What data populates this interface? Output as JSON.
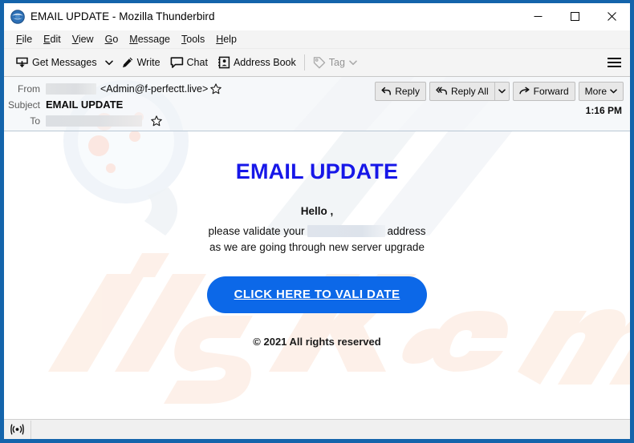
{
  "window": {
    "title": "EMAIL UPDATE - Mozilla Thunderbird",
    "app_icon": "thunderbird-logo-icon",
    "controls": {
      "minimize": "minimize-icon",
      "maximize": "maximize-icon",
      "close": "close-icon"
    },
    "frame_color": "#1464ab"
  },
  "menubar": {
    "items": [
      {
        "accesskey": "F",
        "rest": "ile"
      },
      {
        "accesskey": "E",
        "rest": "dit"
      },
      {
        "accesskey": "V",
        "rest": "iew"
      },
      {
        "accesskey": "G",
        "rest": "o"
      },
      {
        "accesskey": "M",
        "rest": "essage"
      },
      {
        "accesskey": "T",
        "rest": "ools"
      },
      {
        "accesskey": "H",
        "rest": "elp"
      }
    ]
  },
  "toolbar": {
    "get_messages_label": "Get Messages",
    "write_label": "Write",
    "chat_label": "Chat",
    "address_book_label": "Address Book",
    "tag_label": "Tag",
    "tag_disabled": true,
    "app_menu_icon": "hamburger-menu-icon"
  },
  "message_header": {
    "from_label": "From",
    "from_name_redacted": true,
    "from_address": "<Admin@f-perfectt.live>",
    "subject_label": "Subject",
    "subject_value": "EMAIL UPDATE",
    "to_label": "To",
    "to_value_redacted": true,
    "timestamp": "1:16 PM",
    "actions": {
      "reply": "Reply",
      "reply_all": "Reply All",
      "forward": "Forward",
      "more": "More"
    }
  },
  "email_body": {
    "heading": "EMAIL UPDATE",
    "heading_color": "#1717e8",
    "greeting": "Hello ,",
    "line1_before": "please validate your",
    "line1_after": "address",
    "line2": "as we are going through new server upgrade",
    "cta_label": "CLICK HERE TO VALI DATE",
    "cta_color": "#0c68e8",
    "copyright": "© 2021 All rights reserved",
    "watermark_text": "risk.com"
  },
  "statusbar": {
    "icon": "broadcast-signal-icon",
    "text": ""
  }
}
